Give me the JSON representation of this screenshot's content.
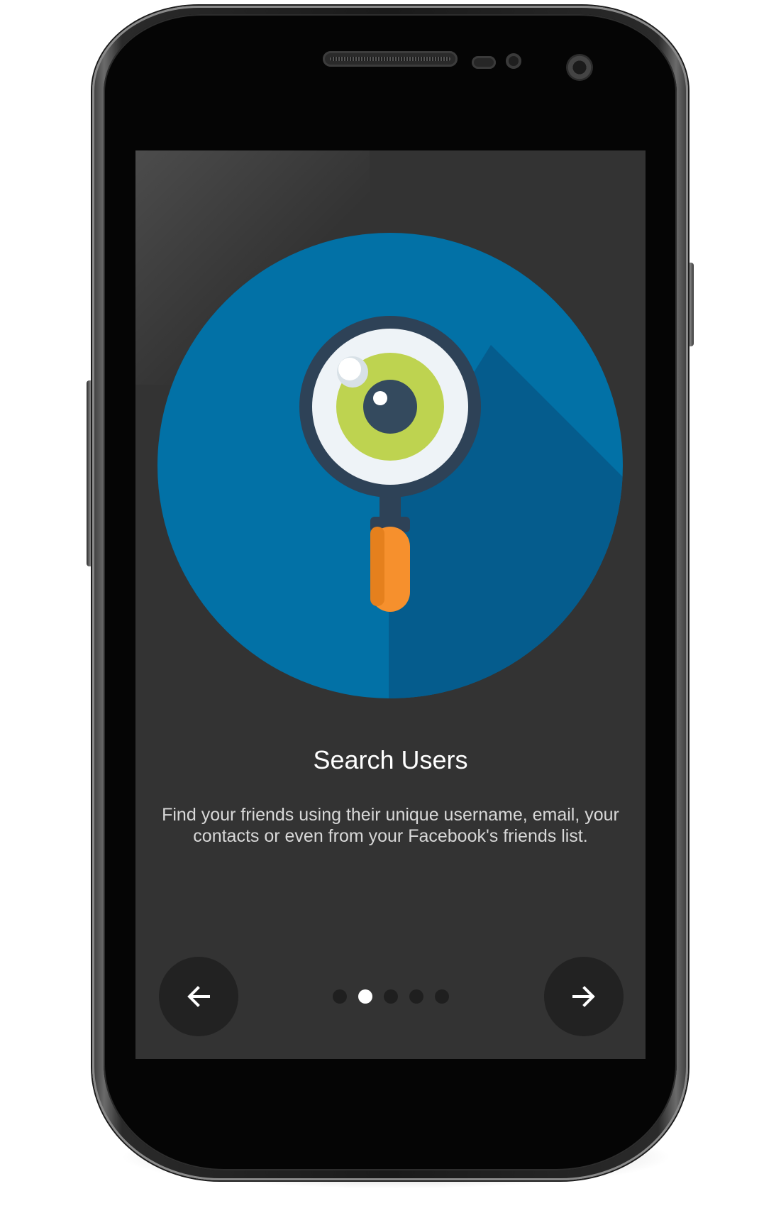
{
  "onboarding": {
    "title": "Search Users",
    "description": "Find your friends using their unique username, email, your\ncontacts or even from your Facebook's friends list.",
    "illustration_icon": "magnifier-eye-icon",
    "prev_icon": "arrow-left-icon",
    "next_icon": "arrow-right-icon",
    "page_count": 5,
    "current_page": 2
  },
  "colors": {
    "screen_background": "#333333",
    "circle_blue": "#0271a6",
    "circle_shadow": "#055c8d",
    "handle_orange": "#f6902d",
    "iris_green": "#bed350",
    "lens_frame": "#2e4257",
    "nav_button": "#222222",
    "dot_inactive": "#1f1f1f",
    "dot_active": "#ffffff"
  }
}
